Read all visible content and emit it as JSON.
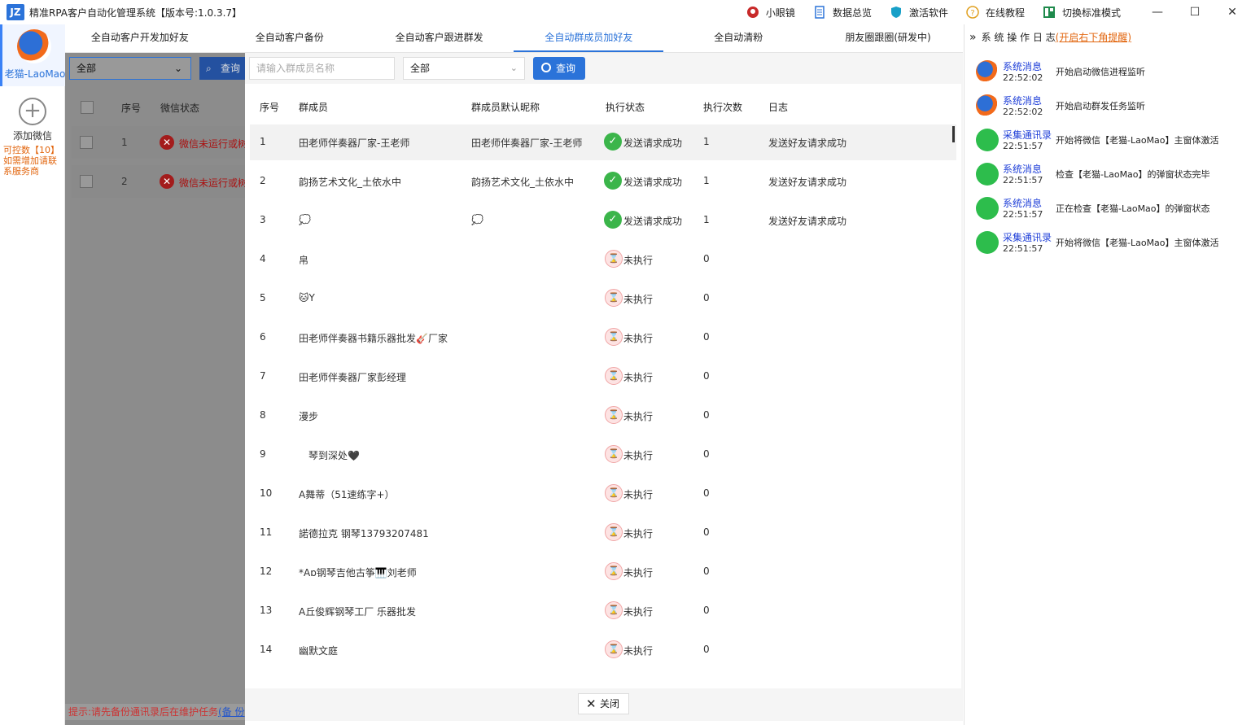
{
  "window": {
    "logo_text": "JZ",
    "title": "精准RPA客户自动化管理系统【版本号:1.0.3.7】",
    "actions": [
      {
        "label": "小眼镜",
        "icon": "glasses-icon"
      },
      {
        "label": "数据总览",
        "icon": "document-icon"
      },
      {
        "label": "激活软件",
        "icon": "shield-icon"
      },
      {
        "label": "在线教程",
        "icon": "help-icon"
      },
      {
        "label": "切换标准模式",
        "icon": "layout-icon"
      }
    ]
  },
  "leftrail": {
    "account_name": "老猫-LaoMao",
    "add_label": "添加微信",
    "quota_line1": "可控数【10】",
    "quota_line2": "如需增加请联系服务商"
  },
  "tabs": [
    {
      "label": "全自动客户开发加好友",
      "active": false
    },
    {
      "label": "全自动客户备份",
      "active": false
    },
    {
      "label": "全自动客户跟进群发",
      "active": false
    },
    {
      "label": "全自动群成员加好友",
      "active": true
    },
    {
      "label": "全自动清粉",
      "active": false
    },
    {
      "label": "朋友圈跟圈(研发中)",
      "active": false
    }
  ],
  "background_page": {
    "select_value": "全部",
    "query_label": "查询",
    "columns": [
      "序号",
      "微信状态"
    ],
    "rows": [
      {
        "index": "1",
        "status": "微信未运行或树"
      },
      {
        "index": "2",
        "status": "微信未运行或树"
      }
    ],
    "bottom_tip": "提示:请先备份通讯录后在维护任务",
    "bottom_link": "(备 份"
  },
  "modal": {
    "search_placeholder": "请输入群成员名称",
    "filter_value": "全部",
    "query_label": "查询",
    "columns": [
      "序号",
      "群成员",
      "群成员默认昵称",
      "执行状态",
      "执行次数",
      "日志"
    ],
    "rows": [
      {
        "index": "1",
        "member": "田老师伴奏器厂家-王老师",
        "nickname": "田老师伴奏器厂家-王老师",
        "status": "发送请求成功",
        "ok": true,
        "count": "1",
        "log": "发送好友请求成功"
      },
      {
        "index": "2",
        "member": "韵扬艺术文化_土依水中",
        "nickname": "韵扬艺术文化_土依水中",
        "status": "发送请求成功",
        "ok": true,
        "count": "1",
        "log": "发送好友请求成功"
      },
      {
        "index": "3",
        "member": "💭",
        "nickname": "💭",
        "status": "发送请求成功",
        "ok": true,
        "count": "1",
        "log": "发送好友请求成功"
      },
      {
        "index": "4",
        "member": "帛",
        "nickname": "",
        "status": "未执行",
        "ok": false,
        "count": "0",
        "log": ""
      },
      {
        "index": "5",
        "member": "🐱Y",
        "nickname": "",
        "status": "未执行",
        "ok": false,
        "count": "0",
        "log": ""
      },
      {
        "index": "6",
        "member": "田老师伴奏器书籍乐器批发🎸厂家",
        "nickname": "",
        "status": "未执行",
        "ok": false,
        "count": "0",
        "log": ""
      },
      {
        "index": "7",
        "member": "田老师伴奏器厂家彭经理",
        "nickname": "",
        "status": "未执行",
        "ok": false,
        "count": "0",
        "log": ""
      },
      {
        "index": "8",
        "member": "漫步",
        "nickname": "",
        "status": "未执行",
        "ok": false,
        "count": "0",
        "log": ""
      },
      {
        "index": "9",
        "member": "　琴到深处🖤",
        "nickname": "",
        "status": "未执行",
        "ok": false,
        "count": "0",
        "log": ""
      },
      {
        "index": "10",
        "member": "A舞蒂（51速练字+）",
        "nickname": "",
        "status": "未执行",
        "ok": false,
        "count": "0",
        "log": ""
      },
      {
        "index": "11",
        "member": "諾德拉克  钢琴13793207481",
        "nickname": "",
        "status": "未执行",
        "ok": false,
        "count": "0",
        "log": ""
      },
      {
        "index": "12",
        "member": "*Aɒ钢琴吉他古筝🎹刘老师",
        "nickname": "",
        "status": "未执行",
        "ok": false,
        "count": "0",
        "log": ""
      },
      {
        "index": "13",
        "member": "A丘俊辉钢琴工厂 乐器批发",
        "nickname": "",
        "status": "未执行",
        "ok": false,
        "count": "0",
        "log": ""
      },
      {
        "index": "14",
        "member": "幽默文庭",
        "nickname": "",
        "status": "未执行",
        "ok": false,
        "count": "0",
        "log": ""
      }
    ],
    "close_label": "关闭"
  },
  "log_panel": {
    "title": "系 统 操 作 日 志",
    "link": "(开启右下角提醒)",
    "items": [
      {
        "type": "sys",
        "source": "系统消息",
        "time": "22:52:02",
        "message": "开始启动微信进程监听"
      },
      {
        "type": "sys",
        "source": "系统消息",
        "time": "22:52:02",
        "message": "开始启动群发任务监听"
      },
      {
        "type": "wx",
        "source": "采集通讯录",
        "time": "22:51:57",
        "message": "开始将微信【老猫-LaoMao】主窗体激活"
      },
      {
        "type": "wx",
        "source": "系统消息",
        "time": "22:51:57",
        "message": "检查【老猫-LaoMao】的弹窗状态完毕"
      },
      {
        "type": "wx",
        "source": "系统消息",
        "time": "22:51:57",
        "message": "正在检查【老猫-LaoMao】的弹窗状态"
      },
      {
        "type": "wx",
        "source": "采集通讯录",
        "time": "22:51:57",
        "message": "开始将微信【老猫-LaoMao】主窗体激活"
      }
    ]
  }
}
